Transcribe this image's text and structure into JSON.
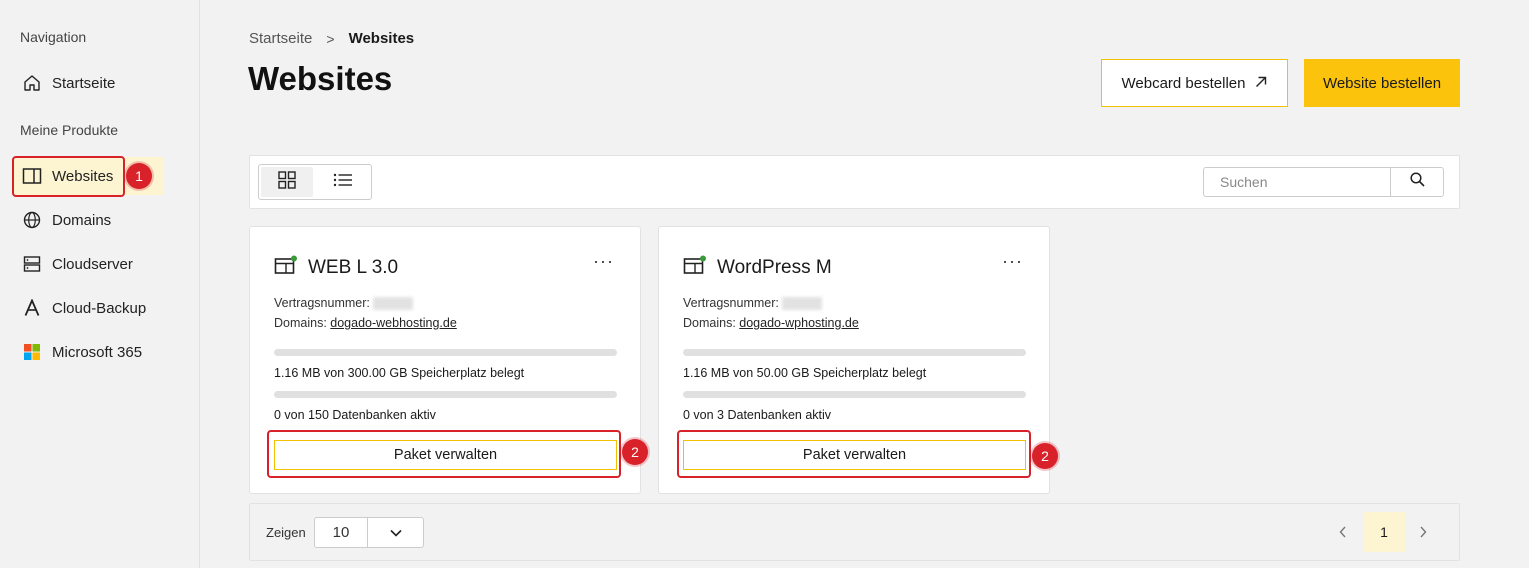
{
  "sidebar": {
    "nav_heading": "Navigation",
    "home_label": "Startseite",
    "products_heading": "Meine Produkte",
    "items": [
      {
        "label": "Websites",
        "icon": "website-icon"
      },
      {
        "label": "Domains",
        "icon": "globe-icon"
      },
      {
        "label": "Cloudserver",
        "icon": "server-icon"
      },
      {
        "label": "Cloud-Backup",
        "icon": "backup-icon"
      },
      {
        "label": "Microsoft 365",
        "icon": "microsoft-icon"
      }
    ]
  },
  "annotations": {
    "step1": "1",
    "step2": "2"
  },
  "breadcrumb": {
    "home": "Startseite",
    "separator": ">",
    "current": "Websites"
  },
  "page": {
    "title": "Websites"
  },
  "actions": {
    "webcard": "Webcard bestellen",
    "website": "Website bestellen"
  },
  "search": {
    "placeholder": "Suchen"
  },
  "cards": [
    {
      "title": "WEB L 3.0",
      "contract_label": "Vertragsnummer:",
      "domains_label": "Domains:",
      "domain": "dogado-webhosting.de",
      "storage_text": "1.16 MB von 300.00 GB Speicherplatz belegt",
      "storage_fraction": 0.0,
      "db_text": "0 von 150 Datenbanken aktiv",
      "db_fraction": 0.0,
      "button": "Paket verwalten"
    },
    {
      "title": "WordPress M",
      "contract_label": "Vertragsnummer:",
      "domains_label": "Domains:",
      "domain": "dogado-wphosting.de",
      "storage_text": "1.16 MB von 50.00 GB Speicherplatz belegt",
      "storage_fraction": 0.0,
      "db_text": "0 von 3 Datenbanken aktiv",
      "db_fraction": 0.0,
      "button": "Paket verwalten"
    }
  ],
  "pagination": {
    "show_label": "Zeigen",
    "per_page": "10",
    "current_page": "1"
  },
  "colors": {
    "accent": "#fcc30d",
    "highlight": "#d9212a",
    "status_dot": "#3a9a3a"
  }
}
